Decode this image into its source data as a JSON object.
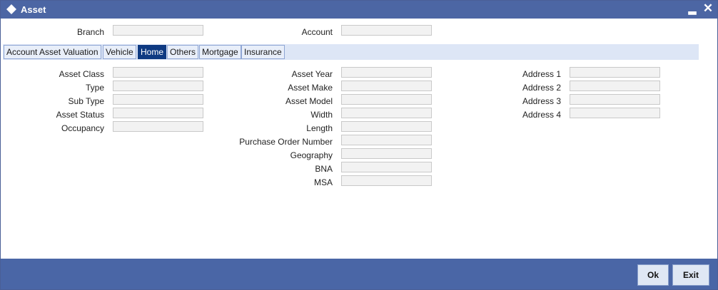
{
  "window": {
    "title": "Asset",
    "minimize_glyph": "▂",
    "close_glyph": "✕"
  },
  "header": {
    "branch_label": "Branch",
    "branch_value": "",
    "account_label": "Account",
    "account_value": ""
  },
  "tabs": [
    {
      "label": "Account Asset Valuation",
      "active": false
    },
    {
      "label": "Vehicle",
      "active": false
    },
    {
      "label": "Home",
      "active": true
    },
    {
      "label": "Others",
      "active": false
    },
    {
      "label": "Mortgage",
      "active": false
    },
    {
      "label": "Insurance",
      "active": false
    }
  ],
  "col1": [
    {
      "label": "Asset Class",
      "value": ""
    },
    {
      "label": "Type",
      "value": ""
    },
    {
      "label": "Sub Type",
      "value": ""
    },
    {
      "label": "Asset Status",
      "value": ""
    },
    {
      "label": "Occupancy",
      "value": ""
    }
  ],
  "col2": [
    {
      "label": "Asset Year",
      "value": ""
    },
    {
      "label": "Asset Make",
      "value": ""
    },
    {
      "label": "Asset Model",
      "value": ""
    },
    {
      "label": "Width",
      "value": ""
    },
    {
      "label": "Length",
      "value": ""
    },
    {
      "label": "Purchase Order Number",
      "value": ""
    },
    {
      "label": "Geography",
      "value": ""
    },
    {
      "label": "BNA",
      "value": ""
    },
    {
      "label": "MSA",
      "value": ""
    }
  ],
  "col3": [
    {
      "label": "Address 1",
      "value": ""
    },
    {
      "label": "Address 2",
      "value": ""
    },
    {
      "label": "Address 3",
      "value": ""
    },
    {
      "label": "Address 4",
      "value": ""
    }
  ],
  "footer": {
    "ok_label": "Ok",
    "exit_label": "Exit"
  },
  "colors": {
    "titlebar": "#4c66a4",
    "active_tab": "#0e3a82",
    "footer": "#4a66a6"
  }
}
